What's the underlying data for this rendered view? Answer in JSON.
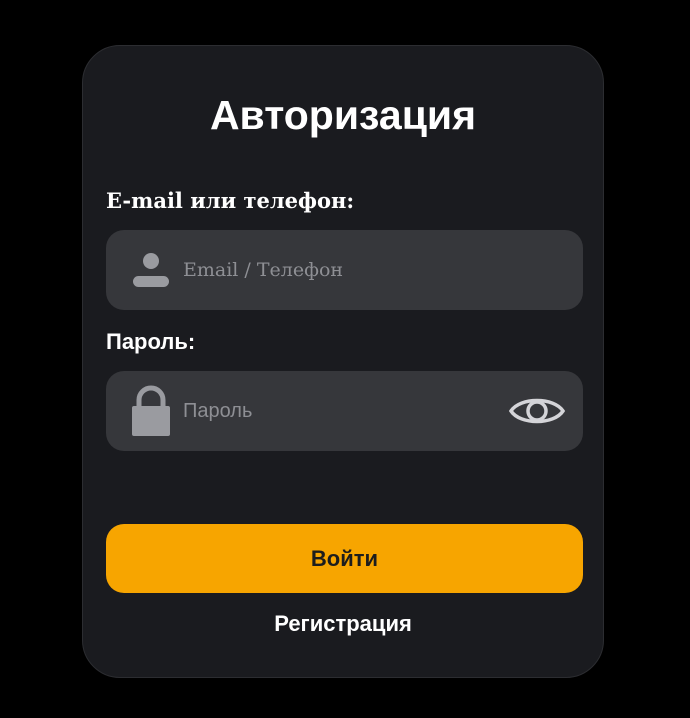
{
  "form": {
    "title": "Авторизация",
    "email_label": "E-mail или телефон:",
    "email_placeholder": "Email / Телефон",
    "email_value": "",
    "email_icon": "user-icon",
    "password_label": "Пароль:",
    "password_placeholder": "Пароль",
    "password_value": "",
    "password_icon": "lock-icon",
    "toggle_icon": "eye-icon",
    "login_label": "Войти",
    "register_label": "Регистрация"
  },
  "colors": {
    "background": "#000000",
    "card": "#1a1b1f",
    "field": "#36373b",
    "accent": "#f7a500",
    "text": "#ffffff",
    "placeholder": "#8e8f94",
    "icon": "#9a9ba0"
  }
}
